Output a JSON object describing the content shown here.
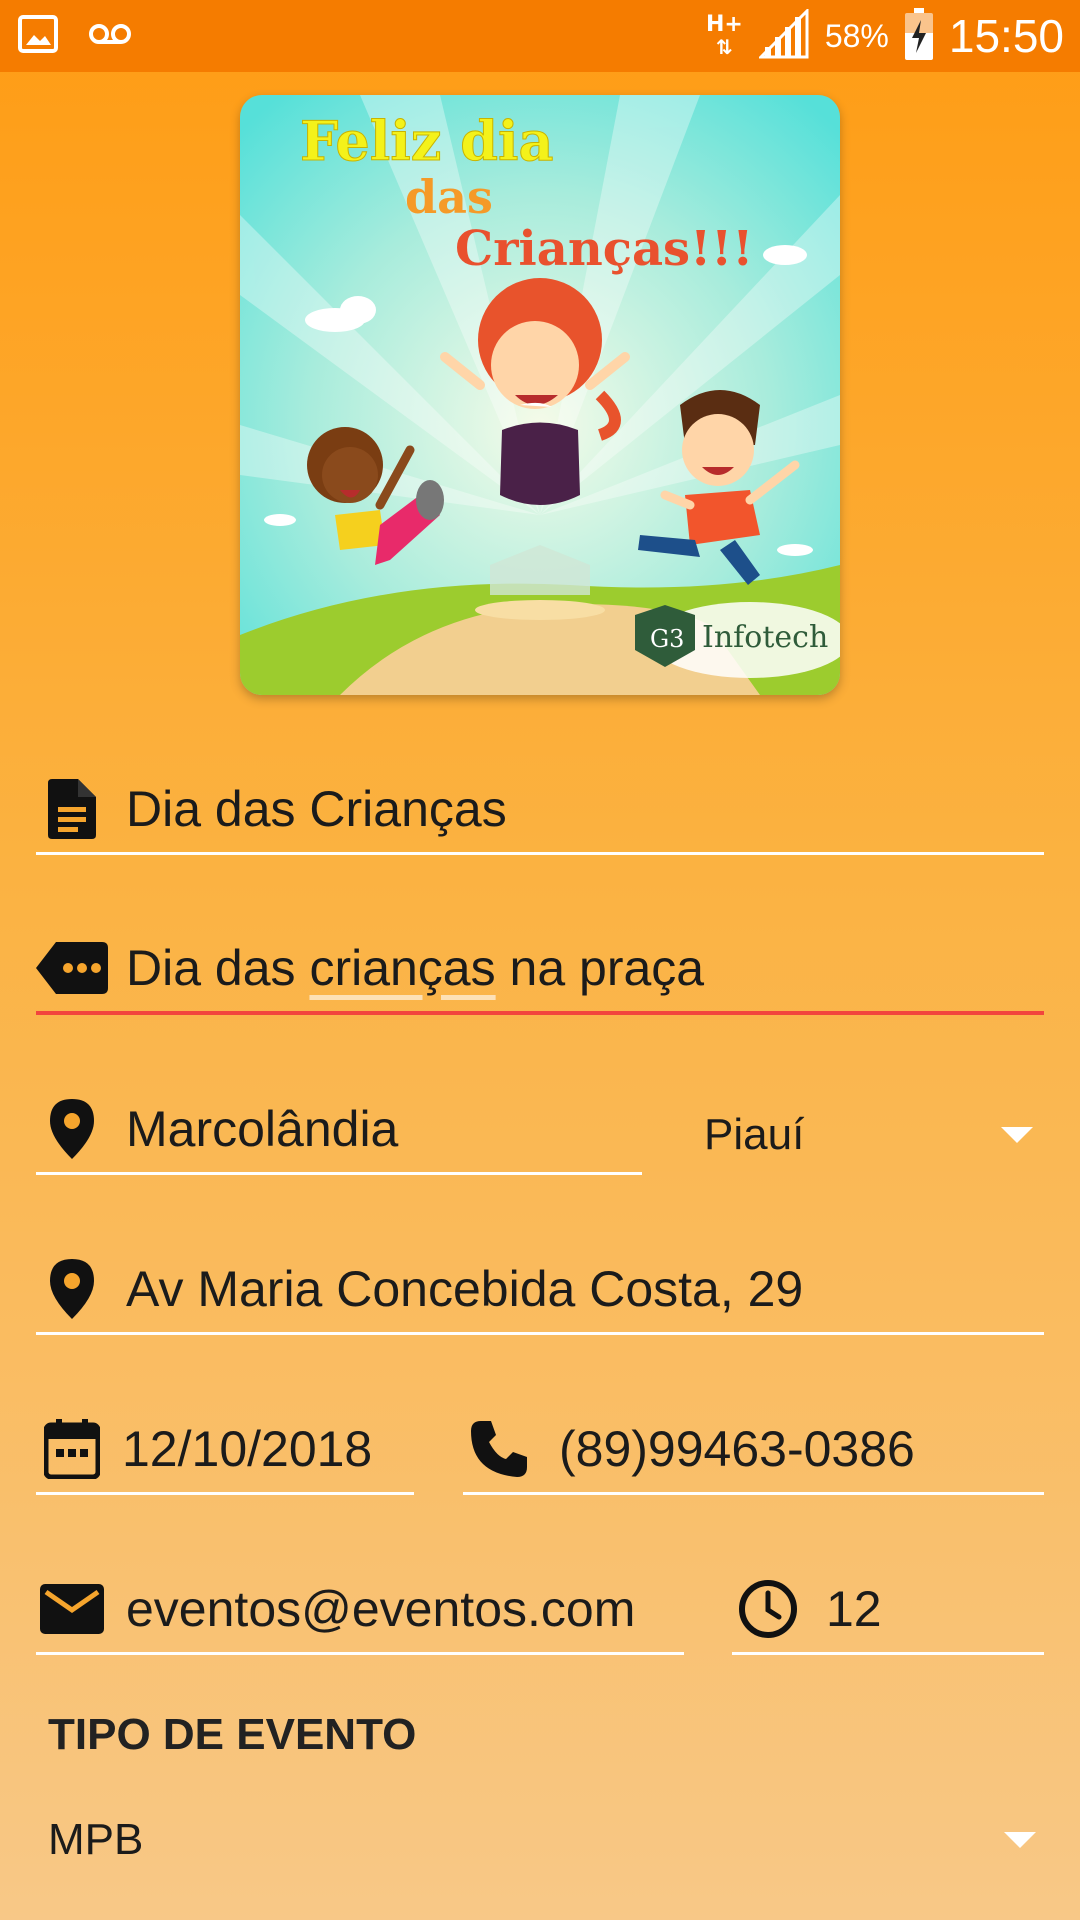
{
  "status_bar": {
    "network": "H+",
    "battery": "58%",
    "time": "15:50",
    "icons": [
      "image-icon",
      "voicemail-icon",
      "signal-icon",
      "battery-charging-icon"
    ]
  },
  "banner": {
    "line1": "Feliz dia",
    "line2": "das",
    "line3": "Crianças!!!",
    "logo_mark": "G3",
    "logo_text": "Infotech"
  },
  "form": {
    "title": {
      "value": "Dia das Crianças",
      "icon": "document-icon"
    },
    "description": {
      "before": "Dia das ",
      "misspelled": "crianças",
      "after": " na praça",
      "icon": "label-icon"
    },
    "city": {
      "value": "Marcolândia",
      "icon": "location-pin-icon"
    },
    "state": {
      "value": "Piauí"
    },
    "address": {
      "value": "Av Maria Concebida Costa, 29",
      "icon": "location-pin-icon"
    },
    "date": {
      "value": "12/10/2018",
      "icon": "calendar-icon"
    },
    "phone": {
      "value": "(89)99463-0386",
      "icon": "phone-icon"
    },
    "email": {
      "value": "eventos@eventos.com",
      "icon": "mail-icon"
    },
    "time": {
      "value": "12",
      "icon": "clock-icon"
    },
    "event_type_label": "TIPO DE EVENTO",
    "event_type": {
      "value": "MPB"
    }
  },
  "colors": {
    "status_bar": "#f57c00",
    "accent_underline": "#f2453d",
    "underline": "#ffffff"
  }
}
